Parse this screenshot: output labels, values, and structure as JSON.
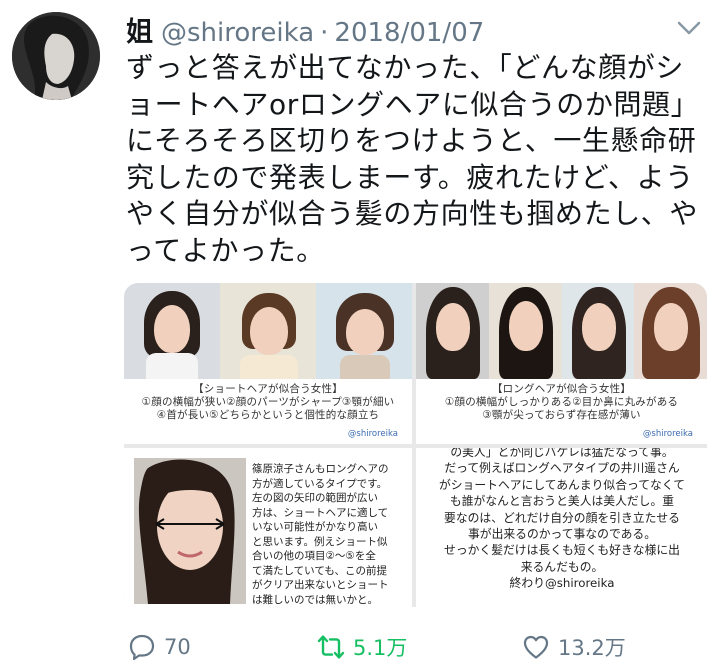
{
  "author": {
    "name": "姐",
    "handle": "@shiroreika",
    "separator": "·",
    "date": "2018/01/07"
  },
  "tweet": {
    "lines": [
      "ずっと答えが出てなかった、「どんな顔がシ",
      "ョートヘアorロングヘアに似合うのか問題」",
      "にそろそろ区切りをつけようと、一生懸命研",
      "究したので発表しまーす。疲れたけど、よう",
      "やく自分が似合う髪の方向性も掴めたし、や",
      "ってよかった。"
    ]
  },
  "media": {
    "panel1": {
      "caption": [
        "【ショートヘアが似合う女性】",
        "①顔の横幅が狭い②顔のパーツがシャープ③顎が細い",
        "④首が長い⑤どちらかというと個性的な顔立ち"
      ],
      "credit": "@shiroreika"
    },
    "panel2": {
      "caption": [
        "【ロングヘアが似合う女性】",
        "①顔の横幅がしっかりある②目か鼻に丸みがある",
        "③顎が尖っておらず存在感が薄い"
      ],
      "credit": "@shiroreika"
    },
    "panel3": {
      "note": [
        "篠原涼子さんもロングヘアの",
        "方が適しているタイプです。",
        "左の図の矢印の範囲が広い",
        "方は、ショートヘアに適して",
        "いない可能性がかなり高い",
        "と思います。例えショート似",
        "合いの他の項目②〜⑤を全",
        "て満たしていても、この前提",
        "がクリア出来ないとショート",
        "は難しいのでは無いかと。"
      ]
    },
    "panel4": {
      "note": [
        "の美人」とか同じバケレは猛だなって事。",
        "だって例えばロングヘアタイプの井川遥さん",
        "がショートヘアにしてあんまり似合ってなくて",
        "も誰がなんと言おうと美人は美人だし。重",
        "要なのは、どれだけ自分の顔を引き立たせる",
        "事が出来るのかって事なのである。",
        "せっかく髪だけは長くも短くも好きな様に出",
        "来るんだもの。",
        "終わり@shiroreika"
      ]
    }
  },
  "actions": {
    "reply": {
      "icon": "reply-icon",
      "count": "70"
    },
    "retweet": {
      "icon": "retweet-icon",
      "count": "5.1万",
      "color": "#17bf63"
    },
    "like": {
      "icon": "heart-icon",
      "count": "13.2万"
    }
  },
  "colors": {
    "text": "#14171a",
    "muted": "#657786",
    "retweet_green": "#17bf63"
  }
}
